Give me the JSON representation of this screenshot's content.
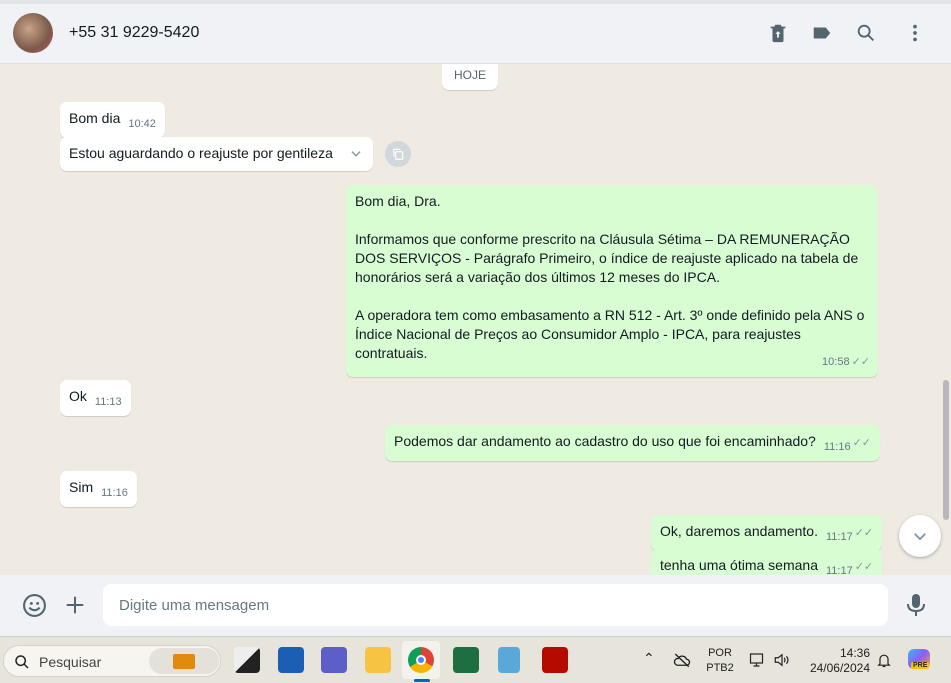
{
  "header": {
    "contact": "+55 31 9229-5420",
    "icons": [
      "delete-icon",
      "label-icon",
      "search-icon",
      "menu-icon"
    ]
  },
  "chat": {
    "day": "HOJE",
    "messages": [
      {
        "dir": "in",
        "text": "Bom dia",
        "time": "10:42"
      },
      {
        "dir": "in",
        "text": "Estou aguardando o reajuste por gentileza"
      },
      {
        "dir": "out",
        "lines": [
          "Bom dia, Dra.",
          "",
          "Informamos que conforme prescrito na Cláusula Sétima – DA REMUNERAÇÃO DOS SERVIÇOS - Parágrafo Primeiro, o índice de reajuste aplicado na tabela de honorários será a variação dos últimos 12 meses do IPCA.",
          "",
          "A operadora tem como embasamento a RN 512 - Art. 3º onde definido pela ANS o Índice Nacional de Preços ao Consumidor Amplo - IPCA, para reajustes contratuais."
        ],
        "time": "10:58"
      },
      {
        "dir": "in",
        "text": "Ok",
        "time": "11:13"
      },
      {
        "dir": "out",
        "text": "Podemos dar andamento ao cadastro do uso que foi encaminhado?",
        "time": "11:16"
      },
      {
        "dir": "in",
        "text": "Sim",
        "time": "11:16"
      },
      {
        "dir": "out",
        "text": "Ok, daremos andamento.",
        "time": "11:17"
      },
      {
        "dir": "out",
        "text": "tenha uma ótima semana",
        "time": "11:17"
      }
    ]
  },
  "footer": {
    "placeholder": "Digite uma mensagem"
  },
  "taskbar": {
    "search": "Pesquisar",
    "lang1": "POR",
    "lang2": "PTB2",
    "time": "14:36",
    "date": "24/06/2024",
    "copilot_badge": "PRE"
  }
}
